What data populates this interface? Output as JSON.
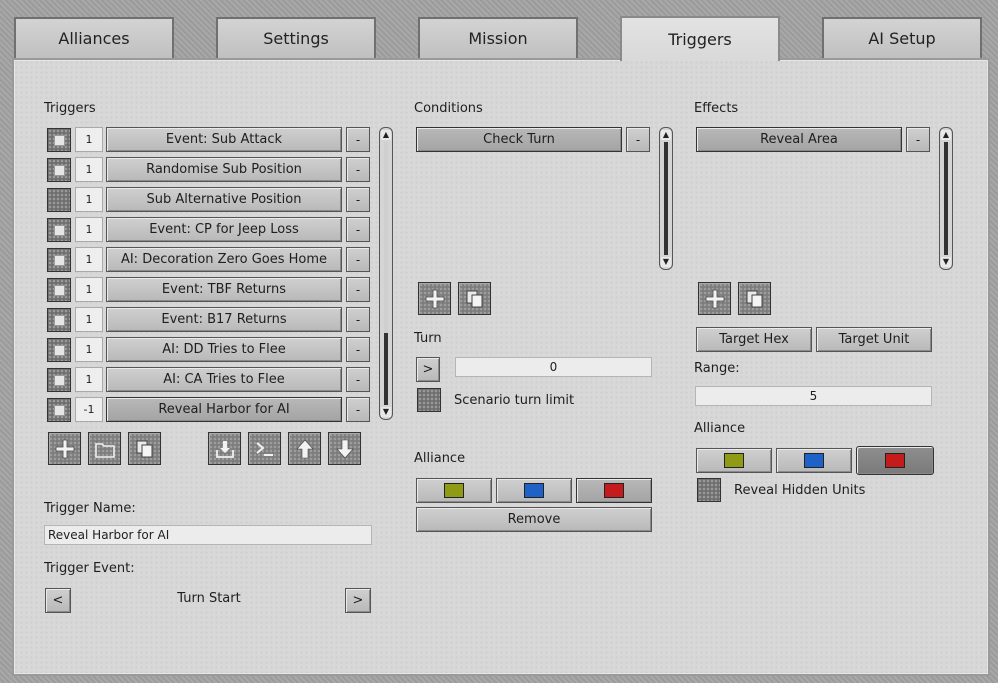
{
  "tabs": [
    "Alliances",
    "Settings",
    "Mission",
    "Triggers",
    "AI Setup"
  ],
  "active_tab": "Triggers",
  "triggers": {
    "label": "Triggers",
    "items": [
      {
        "num": "1",
        "name": "Event: Sub Attack",
        "checked": true
      },
      {
        "num": "1",
        "name": "Randomise Sub Position",
        "checked": true
      },
      {
        "num": "1",
        "name": "Sub Alternative Position",
        "checked": false
      },
      {
        "num": "1",
        "name": "Event: CP for Jeep Loss",
        "checked": true
      },
      {
        "num": "1",
        "name": "AI: Decoration Zero Goes Home",
        "checked": true
      },
      {
        "num": "1",
        "name": "Event: TBF Returns",
        "checked": true
      },
      {
        "num": "1",
        "name": "Event: B17 Returns",
        "checked": true
      },
      {
        "num": "1",
        "name": "AI: DD Tries to Flee",
        "checked": true
      },
      {
        "num": "1",
        "name": "AI: CA Tries to Flee",
        "checked": true
      },
      {
        "num": "-1",
        "name": "Reveal Harbor for AI",
        "checked": true,
        "selected": true
      }
    ],
    "remove_label": "-",
    "name_label": "Trigger Name:",
    "name_value": "Reveal Harbor for AI",
    "event_label": "Trigger Event:",
    "event_value": "Turn Start",
    "prev": "<",
    "next": ">"
  },
  "conditions": {
    "label": "Conditions",
    "items": [
      {
        "name": "Check Turn"
      }
    ],
    "remove_label": "-",
    "turn_label": "Turn",
    "turn_op": ">",
    "turn_value": "0",
    "turn_limit_label": "Scenario turn limit",
    "alliance_label": "Alliance",
    "alliance_colors": [
      "#8f9b14",
      "#1e62c8",
      "#c41c1c"
    ],
    "remove_button": "Remove"
  },
  "effects": {
    "label": "Effects",
    "items": [
      {
        "name": "Reveal Area"
      }
    ],
    "remove_label": "-",
    "target_hex": "Target Hex",
    "target_unit": "Target Unit",
    "range_label": "Range:",
    "range_value": "5",
    "alliance_label": "Alliance",
    "alliance_colors": [
      "#8f9b14",
      "#1e62c8",
      "#c41c1c"
    ],
    "reveal_hidden_label": "Reveal Hidden Units"
  }
}
